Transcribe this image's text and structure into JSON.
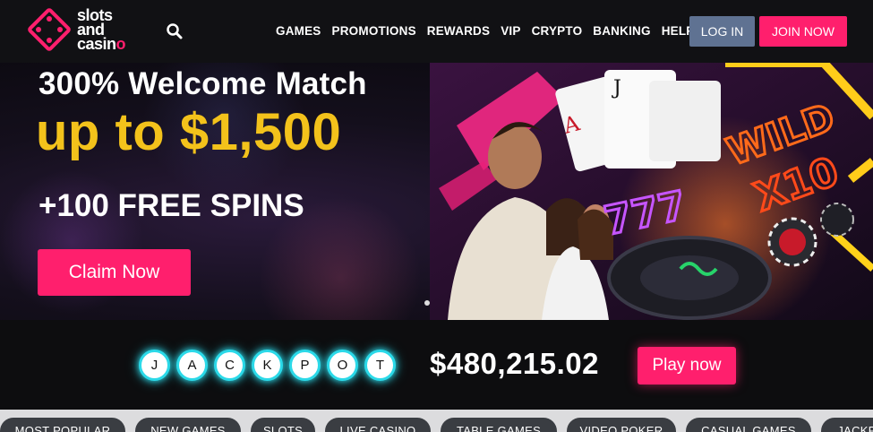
{
  "brand": {
    "line1": "slots",
    "line2": "and",
    "line3a": "casin",
    "line3b": "o",
    "accent_color": "#ff1f6d"
  },
  "header": {
    "search_icon": "search-icon",
    "nav": [
      "GAMES",
      "PROMOTIONS",
      "REWARDS",
      "VIP",
      "CRYPTO",
      "BANKING",
      "HELP"
    ],
    "login_label": "LOG IN",
    "join_label": "JOIN NOW"
  },
  "hero": {
    "line1": "300% Welcome Match",
    "line2": "up to $1,500",
    "line3": "+100 FREE SPINS",
    "cta": "Claim Now",
    "art_text1": "WILD",
    "art_text2": "X10",
    "art_slot": "777",
    "card1": "A",
    "card2": "J",
    "highlight_color": "#f3c21b"
  },
  "jackpot": {
    "letters": [
      "J",
      "A",
      "C",
      "K",
      "P",
      "O",
      "T"
    ],
    "amount": "$480,215.02",
    "cta": "Play now",
    "glow_color": "#2bd9e8"
  },
  "categories": [
    "MOST POPULAR",
    "NEW GAMES",
    "SLOTS",
    "LIVE CASINO",
    "TABLE GAMES",
    "VIDEO POKER",
    "CASUAL GAMES",
    "JACKP"
  ]
}
